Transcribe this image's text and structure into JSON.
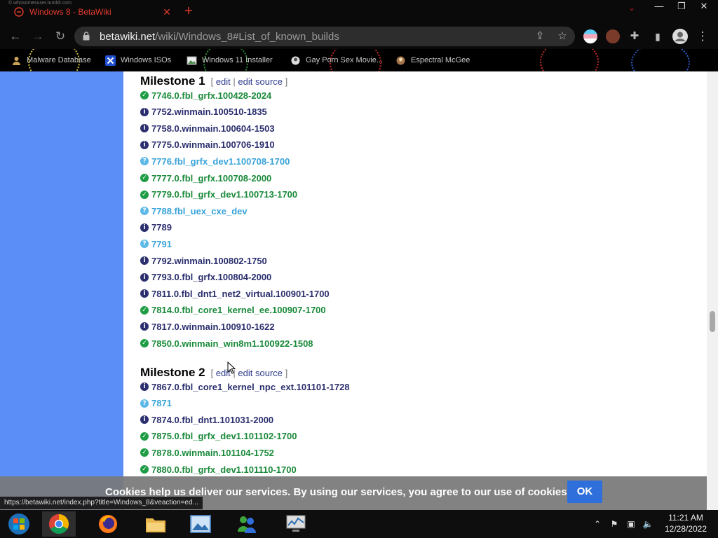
{
  "browser": {
    "tiny_text": "© whosomesuser.tumblr.com",
    "tab_title": "Windows 8 - BetaWiki",
    "url_host": "betawiki.net",
    "url_path": "/wiki/Windows_8#List_of_known_builds",
    "status_url": "https://betawiki.net/index.php?title=Windows_8&veaction=ed..."
  },
  "icons": {
    "back": "←",
    "forward": "→",
    "reload": "↻",
    "share": "⇪",
    "star": "☆",
    "puzzle": "✚",
    "menu": "⋮",
    "tab_close": "✕",
    "new_tab": "+",
    "minimize": "—",
    "restore": "❐",
    "win_close": "✕",
    "chevron": "⌄"
  },
  "bookmarks": [
    {
      "label": "Malware Database",
      "icon": "avatar-icon"
    },
    {
      "label": "Windows ISOs",
      "icon": "x-logo-icon"
    },
    {
      "label": "Windows 11 Installer",
      "icon": "image-icon"
    },
    {
      "label": "Gay Porn Sex Movie...",
      "icon": "bookmark-site-icon"
    },
    {
      "label": "Espectral McGee",
      "icon": "bookmark-site-icon"
    }
  ],
  "sections": [
    {
      "title": "Milestone 1",
      "edit_open": "[ ",
      "edit_label": "edit",
      "sep": " | ",
      "edit_source_label": "edit source",
      "edit_close": " ]",
      "builds": [
        {
          "name": "7746.0.fbl_grfx.100428-2024",
          "status": "ok"
        },
        {
          "name": "7752.winmain.100510-1835",
          "status": "info"
        },
        {
          "name": "7758.0.winmain.100604-1503",
          "status": "info"
        },
        {
          "name": "7775.0.winmain.100706-1910",
          "status": "info"
        },
        {
          "name": "7776.fbl_grfx_dev1.100708-1700",
          "status": "unk"
        },
        {
          "name": "7777.0.fbl_grfx.100708-2000",
          "status": "ok"
        },
        {
          "name": "7779.0.fbl_grfx_dev1.100713-1700",
          "status": "ok"
        },
        {
          "name": "7788.fbl_uex_cxe_dev",
          "status": "unk"
        },
        {
          "name": "7789",
          "status": "info"
        },
        {
          "name": "7791",
          "status": "unk"
        },
        {
          "name": "7792.winmain.100802-1750",
          "status": "info"
        },
        {
          "name": "7793.0.fbl_grfx.100804-2000",
          "status": "info"
        },
        {
          "name": "7811.0.fbl_dnt1_net2_virtual.100901-1700",
          "status": "info"
        },
        {
          "name": "7814.0.fbl_core1_kernel_ee.100907-1700",
          "status": "ok"
        },
        {
          "name": "7817.0.winmain.100910-1622",
          "status": "info"
        },
        {
          "name": "7850.0.winmain_win8m1.100922-1508",
          "status": "ok"
        }
      ]
    },
    {
      "title": "Milestone 2",
      "edit_open": "[ ",
      "edit_label": "edit",
      "sep": " | ",
      "edit_source_label": "edit source",
      "edit_close": " ]",
      "builds": [
        {
          "name": "7867.0.fbl_core1_kernel_npc_ext.101101-1728",
          "status": "info"
        },
        {
          "name": "7871",
          "status": "unk"
        },
        {
          "name": "7874.0.fbl_dnt1.101031-2000",
          "status": "info"
        },
        {
          "name": "7875.0.fbl_grfx_dev1.101102-1700",
          "status": "ok"
        },
        {
          "name": "7878.0.winmain.101104-1752",
          "status": "ok"
        },
        {
          "name": "7880.0.fbl_grfx_dev1.101110-1700",
          "status": "ok"
        }
      ]
    }
  ],
  "status_glyphs": {
    "ok": "✓",
    "info": "i",
    "unk": "?"
  },
  "cookie": {
    "message": "Cookies help us deliver our services. By using our services, you agree to our use of cookies.",
    "ok_label": "OK"
  },
  "taskbar": {
    "apps": [
      {
        "name": "windows-orb",
        "active": false
      },
      {
        "name": "chrome",
        "active": true
      },
      {
        "name": "firefox",
        "active": false
      },
      {
        "name": "file-explorer",
        "active": false
      },
      {
        "name": "photo-viewer",
        "active": false
      },
      {
        "name": "messenger",
        "active": false
      },
      {
        "name": "monitor",
        "active": false
      }
    ],
    "tray_icons": {
      "up": "⌃",
      "flag": "⚑",
      "network": "▣",
      "volume": "🔈"
    },
    "time": "11:21 AM",
    "date": "12/28/2022"
  },
  "colors": {
    "ok": "#1a8a3a",
    "info": "#2b2f6e",
    "unk": "#38a3d8",
    "sidebar": "#5b8ef7",
    "tab_accent": "#e53a2e",
    "ok_button": "#2f6fdc"
  }
}
